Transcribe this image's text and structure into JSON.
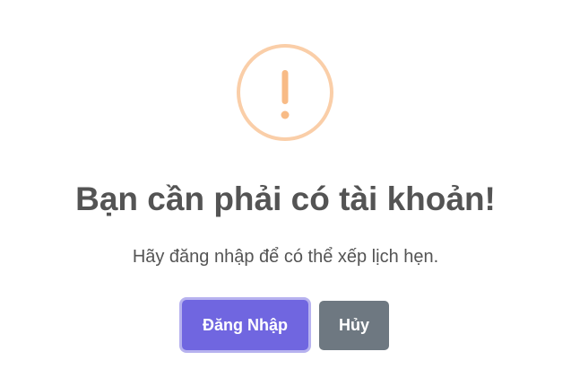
{
  "dialog": {
    "icon": "warning-exclamation-icon",
    "icon_color": "#f8bb86",
    "title": "Bạn cần phải có tài khoản!",
    "message": "Hãy đăng nhập để có thể xếp lịch hẹn.",
    "confirm_label": "Đăng Nhập",
    "cancel_label": "Hủy",
    "confirm_color": "#7066e0",
    "cancel_color": "#6e7881"
  }
}
